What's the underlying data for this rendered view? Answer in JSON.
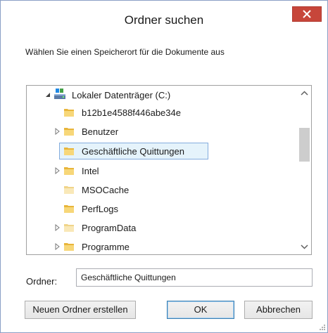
{
  "dialog": {
    "title": "Ordner suchen",
    "instruction": "Wählen Sie einen Speicherort für die Dokumente aus"
  },
  "tree": {
    "root": {
      "label": "Lokaler Datenträger (C:)",
      "icon": "drive-icon",
      "expanded": true
    },
    "items": [
      {
        "label": "b12b1e4588f446abe34e",
        "has_children": false,
        "selected": false,
        "icon": "folder-icon"
      },
      {
        "label": "Benutzer",
        "has_children": true,
        "selected": false,
        "icon": "folder-icon"
      },
      {
        "label": "Geschäftliche Quittungen",
        "has_children": false,
        "selected": true,
        "icon": "folder-icon"
      },
      {
        "label": "Intel",
        "has_children": true,
        "selected": false,
        "icon": "folder-icon"
      },
      {
        "label": "MSOCache",
        "has_children": false,
        "selected": false,
        "icon": "folder-icon"
      },
      {
        "label": "PerfLogs",
        "has_children": false,
        "selected": false,
        "icon": "folder-icon"
      },
      {
        "label": "ProgramData",
        "has_children": true,
        "selected": false,
        "icon": "folder-icon"
      },
      {
        "label": "Programme",
        "has_children": true,
        "selected": false,
        "icon": "folder-icon"
      }
    ]
  },
  "folder_field": {
    "label": "Ordner:",
    "value": "Geschäftliche Quittungen"
  },
  "buttons": {
    "new_folder": "Neuen Ordner erstellen",
    "ok": "OK",
    "cancel": "Abbrechen"
  },
  "colors": {
    "close_button": "#c7463a",
    "selection_bg": "#e5f3fb",
    "selection_border": "#84acdd",
    "folder_yellow": "#e8b53a"
  }
}
